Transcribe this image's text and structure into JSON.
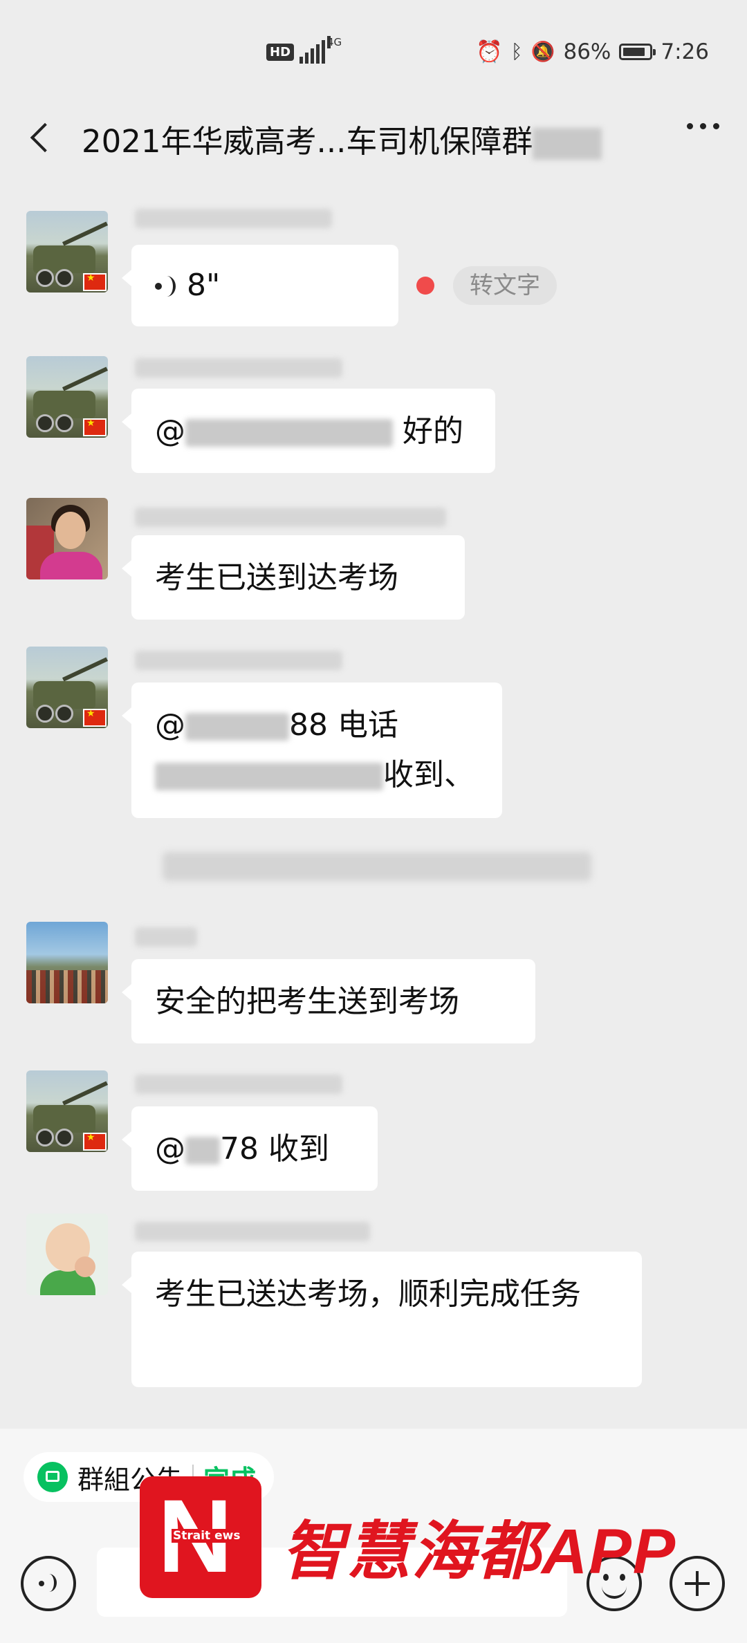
{
  "status_bar": {
    "hd": "HD",
    "network": "4G",
    "battery": "86%",
    "battery_level": 0.86,
    "time": "7:26"
  },
  "header": {
    "title": "2021年华威高考...车司机保障群"
  },
  "messages": [
    {
      "type": "voice",
      "duration": "8\"",
      "to_text_label": "转文字",
      "unread": true
    },
    {
      "type": "text",
      "prefix": "@",
      "text": "好的"
    },
    {
      "type": "text",
      "text": "考生已送到达考场"
    },
    {
      "type": "text",
      "line1_prefix": "@",
      "line1_mid": "88 电话",
      "line2_end": "收到、"
    },
    {
      "type": "text",
      "text": "安全的把考生送到考场"
    },
    {
      "type": "text",
      "prefix": "@",
      "mid": "78  收到"
    },
    {
      "type": "text",
      "text": "考生已送达考场，顺利完成任务"
    }
  ],
  "bottom": {
    "notice_label": "群組公告",
    "notice_done": "完成"
  },
  "watermark": {
    "logo_letter": "N",
    "logo_small": "Strait ews",
    "brand": "智慧海都APP"
  },
  "colors": {
    "wechat_green": "#07c160",
    "brand_red": "#e0151f",
    "unread_red": "#f04b4b"
  }
}
